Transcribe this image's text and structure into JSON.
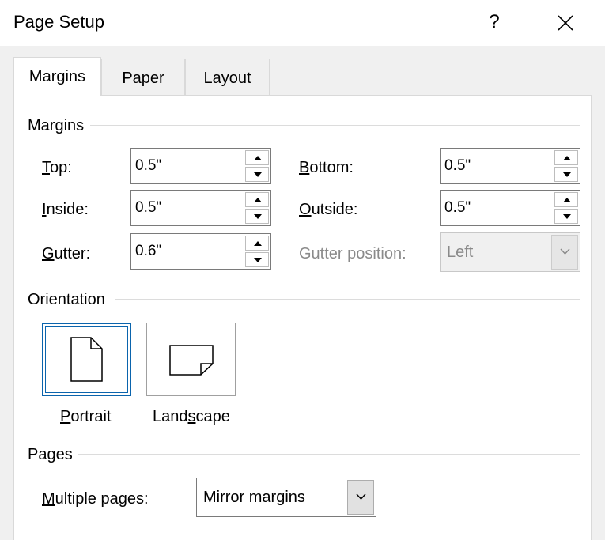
{
  "dialog": {
    "title": "Page Setup",
    "help_label": "?",
    "close_icon": "close-icon"
  },
  "tabs": [
    {
      "label": "Margins",
      "selected": true
    },
    {
      "label": "Paper",
      "selected": false
    },
    {
      "label": "Layout",
      "selected": false
    }
  ],
  "margins": {
    "group_label": "Margins",
    "top": {
      "label_key": "T",
      "label_rest": "op:",
      "value": "0.5\""
    },
    "inside": {
      "label_key": "I",
      "label_rest": "nside:",
      "value": "0.5\""
    },
    "gutter": {
      "label_key": "G",
      "label_rest": "utter:",
      "value": "0.6\""
    },
    "bottom": {
      "label_key": "B",
      "label_rest": "ottom:",
      "value": "0.5\""
    },
    "outside": {
      "label_key": "O",
      "label_rest": "utside:",
      "value": "0.5\""
    },
    "gutter_position": {
      "label": "Gutter position:",
      "value": "Left",
      "enabled": false
    }
  },
  "orientation": {
    "group_label": "Orientation",
    "portrait": {
      "label_key": "P",
      "label_rest": "ortrait",
      "selected": true,
      "icon": "portrait-page-icon"
    },
    "landscape": {
      "label_pre": "Land",
      "label_key": "s",
      "label_rest": "cape",
      "selected": false,
      "icon": "landscape-page-icon"
    }
  },
  "pages": {
    "group_label": "Pages",
    "multiple_pages": {
      "label_key": "M",
      "label_rest": "ultiple pages:",
      "value": "Mirror margins"
    }
  },
  "colors": {
    "selection_border": "#0a64ad",
    "disabled_text": "#8a8a8a"
  }
}
